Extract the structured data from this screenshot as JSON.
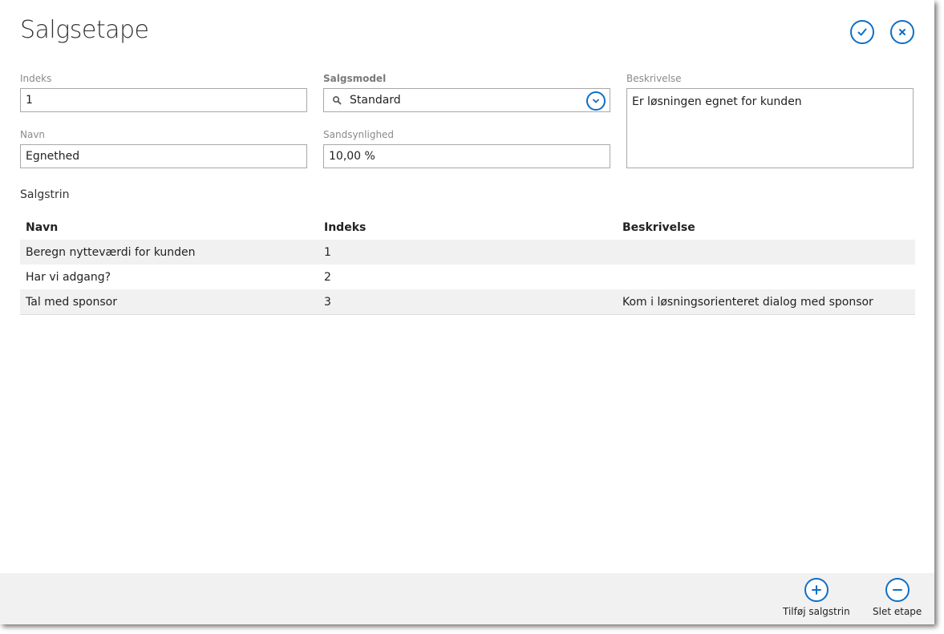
{
  "header": {
    "title": "Salgsetape",
    "confirm_icon": "check-icon",
    "close_icon": "close-icon"
  },
  "form": {
    "index": {
      "label": "Indeks",
      "value": "1"
    },
    "name": {
      "label": "Navn",
      "value": "Egnethed"
    },
    "sales_model": {
      "label": "Salgsmodel",
      "value": "Standard"
    },
    "probability": {
      "label": "Sandsynlighed",
      "value": "10,00 %"
    },
    "description": {
      "label": "Beskrivelse",
      "value": "Er løsningen egnet for kunden"
    }
  },
  "steps": {
    "section_label": "Salgstrin",
    "columns": [
      "Navn",
      "Indeks",
      "Beskrivelse"
    ],
    "rows": [
      {
        "name": "Beregn nytteværdi for kunden",
        "index": "1",
        "description": ""
      },
      {
        "name": "Har vi adgang?",
        "index": "2",
        "description": ""
      },
      {
        "name": "Tal med sponsor",
        "index": "3",
        "description": "Kom i løsningsorienteret dialog med sponsor"
      }
    ]
  },
  "footer": {
    "add_label": "Tilføj salgstrin",
    "delete_label": "Slet etape"
  },
  "colors": {
    "accent": "#0f6fc6",
    "row_alt": "#f1f1f1",
    "footer_bg": "#f1f1f1"
  }
}
